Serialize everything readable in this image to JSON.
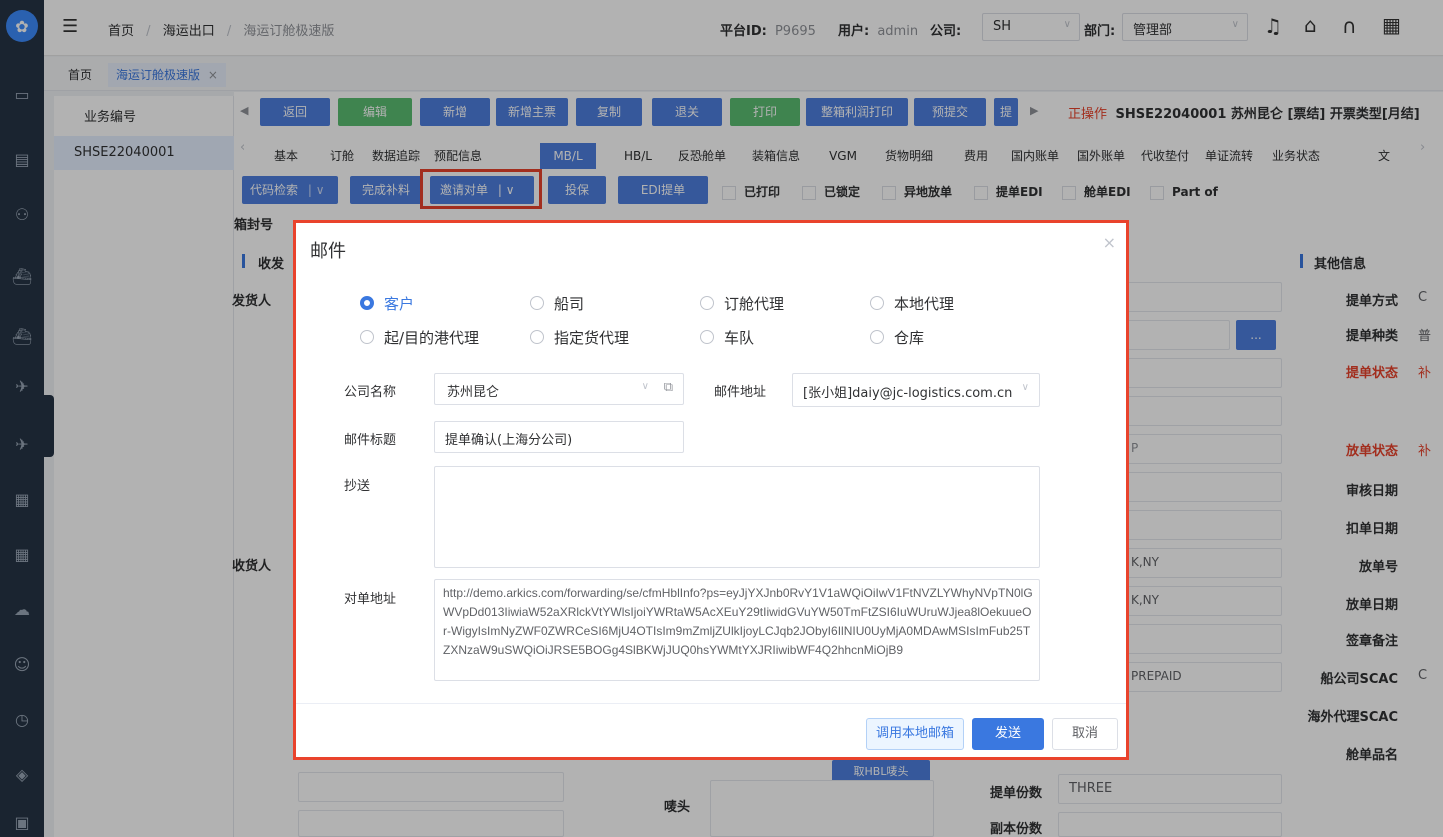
{
  "header": {
    "breadcrumb": [
      "首页",
      "海运出口",
      "海运订舱极速版"
    ],
    "platform_label": "平台ID:",
    "platform_id": "P9695",
    "user_label": "用户:",
    "user": "admin",
    "company_label": "公司:",
    "company": "SH",
    "dept_label": "部门:",
    "dept": "管理部"
  },
  "tabs": {
    "home": "首页",
    "current": "海运订舱极速版",
    "close": "×"
  },
  "left_panel": {
    "header": "业务编号",
    "selected": "SHSE22040001"
  },
  "toolbar": {
    "buttons": [
      "返回",
      "编辑",
      "新增",
      "新增主票",
      "复制",
      "退关",
      "打印",
      "整箱利润打印",
      "预提交",
      "提"
    ],
    "status_prefix": "正操作",
    "status_text": "SHSE22040001  苏州昆仑 [票结]  开票类型[月结]"
  },
  "nav_tabs": [
    "基本",
    "订舱",
    "数据追踪",
    "预配信息",
    "MB/L",
    "HB/L",
    "反恐舱单",
    "装箱信息",
    "VGM",
    "货物明细",
    "费用",
    "国内账单",
    "国外账单",
    "代收垫付",
    "单证流转",
    "业务状态",
    "文"
  ],
  "actions": {
    "code_search": "代码检索",
    "complete": "完成补料",
    "invite": "邀请对单",
    "insure": "投保",
    "edi": "EDI提单",
    "checks": [
      "已打印",
      "已锁定",
      "异地放单",
      "提单EDI",
      "舱单EDI",
      "Part of"
    ]
  },
  "form_bg": {
    "seal_label": "箱封号",
    "section_left": "收发",
    "shipper": "发货人",
    "consignee": "收货人",
    "ny1": "K,NY",
    "ny2": "K,NY",
    "prepaid": "PREPAID",
    "mark_label": "唛头",
    "hbl_btn": "取HBL唛头",
    "bl_count_label": "提单份数",
    "bl_count": "THREE",
    "copy_count_label": "副本份数",
    "dots": "...",
    "small_p": "P",
    "side_title": "其他信息",
    "side_labels": [
      "提单方式",
      "提单种类",
      "提单状态",
      "放单状态",
      "审核日期",
      "扣单日期",
      "放单号",
      "放单日期",
      "签章备注",
      "船公司SCAC",
      "海外代理SCAC",
      "舱单品名"
    ],
    "side_vals": [
      "C",
      "普",
      "补",
      "补",
      "C"
    ]
  },
  "dialog": {
    "title": "邮件",
    "close": "×",
    "radios": [
      "客户",
      "船司",
      "订舱代理",
      "本地代理",
      "起/目的港代理",
      "指定货代理",
      "车队",
      "仓库"
    ],
    "selected_radio": "客户",
    "company_label": "公司名称",
    "company_value": "苏州昆仑",
    "email_label": "邮件地址",
    "email_value": "[张小姐]daiy@jc-logistics.com.cn",
    "subject_label": "邮件标题",
    "subject_value": "提单确认(上海分公司)",
    "cc_label": "抄送",
    "cc_value": "",
    "url_label": "对单地址",
    "url_value": "http://demo.arkics.com/forwarding/se/cfmHblInfo?ps=eyJjYXJnb0RvY1V1aWQiOiIwV1FtNVZLYWhyNVpTN0lGWVpDd013IiwiaW52aXRlckVtYWlsIjoiYWRtaW5AcXEuY29tIiwidGVuYW50TmFtZSI6IuWUruWJjea8lOekuueOr-WigyIsImNyZWF0ZWRCeSI6MjU4OTIsIm9mZmljZUlkIjoyLCJqb2JObyI6IlNIU0UyMjA0MDAwMSIsImFub25TZXNzaW9uSWQiOiJRSE5BOGg4SlBKWjJUQ0hsYWMtYXJRIiwibWF4Q2hhcnMiOjB9",
    "btn_local": "调用本地邮箱",
    "btn_send": "发送",
    "btn_cancel": "取消"
  },
  "colors": {
    "accent": "#4e7fdf",
    "highlight": "#e9432c",
    "sidebar": "#263445",
    "green": "#5bbd72"
  }
}
